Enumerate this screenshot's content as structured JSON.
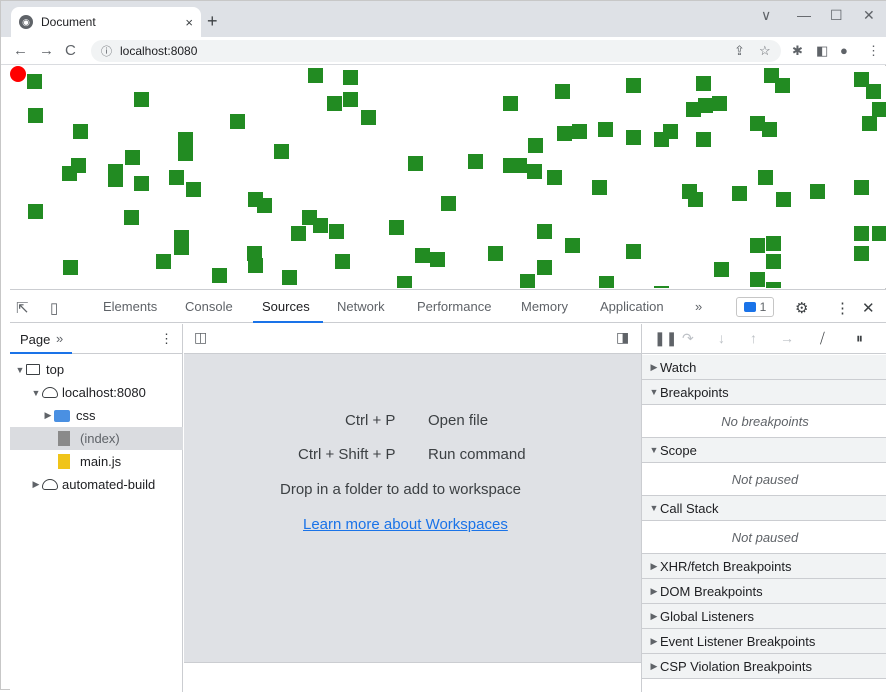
{
  "browser": {
    "tab_title": "Document",
    "tab_close": "×",
    "new_tab": "+",
    "url": "localhost:8080",
    "win_minimize": "—",
    "win_maximize": "☐",
    "win_close": "✕",
    "win_chevron": "∨"
  },
  "page": {
    "square_color": "#228b22",
    "dot_color": "#ff0000"
  },
  "devtools": {
    "tabs": [
      "Elements",
      "Console",
      "Sources",
      "Network",
      "Performance",
      "Memory",
      "Application"
    ],
    "more_tabs": "»",
    "active_tab": "Sources",
    "issues_count": "1",
    "navigator": {
      "tab": "Page",
      "more": "»",
      "tree": [
        {
          "label": "top"
        },
        {
          "label": "localhost:8080"
        },
        {
          "label": "css"
        },
        {
          "label": "(index)"
        },
        {
          "label": "main.js"
        },
        {
          "label": "automated-build"
        }
      ]
    },
    "editor": {
      "shortcut1_keys": "Ctrl + P",
      "shortcut1_action": "Open file",
      "shortcut2_keys": "Ctrl + Shift + P",
      "shortcut2_action": "Run command",
      "drop_text": "Drop in a folder to add to workspace",
      "workspace_link": "Learn more about Workspaces"
    },
    "debugger": {
      "watch": "Watch",
      "breakpoints": "Breakpoints",
      "no_breakpoints": "No breakpoints",
      "scope": "Scope",
      "scope_status": "Not paused",
      "call_stack": "Call Stack",
      "call_stack_status": "Not paused",
      "xhr": "XHR/fetch Breakpoints",
      "dom": "DOM Breakpoints",
      "global": "Global Listeners",
      "event": "Event Listener Breakpoints",
      "csp": "CSP Violation Breakpoints"
    }
  }
}
